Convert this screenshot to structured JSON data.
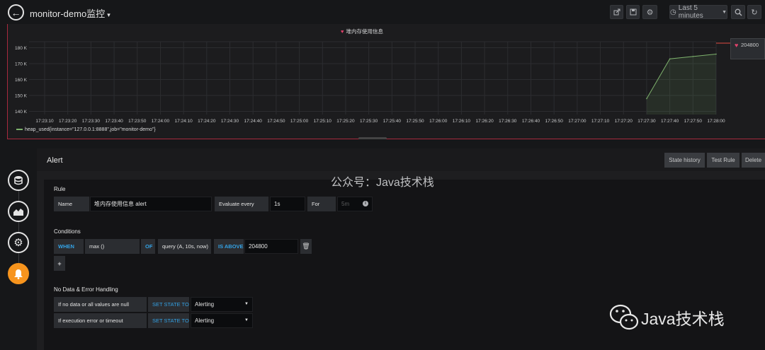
{
  "topbar": {
    "back_icon": "arrow-left-icon",
    "title": "monitor-demo监控",
    "title_caret": "▾",
    "time_range": "Last 5 minutes",
    "share_icon": "share-icon",
    "save_icon": "save-icon",
    "settings_icon": "gear-icon",
    "clock_icon": "clock-icon",
    "zoom_icon": "zoom-out-icon",
    "refresh_icon": "refresh-icon"
  },
  "panel": {
    "title": "堆内存使用信息",
    "threshold_label": "204800",
    "legend": "heap_used{instance=\"127.0.0.1:8888\",job=\"monitor-demo\"}"
  },
  "chart_data": {
    "type": "area",
    "title": "堆内存使用信息",
    "xlabel": "",
    "ylabel": "",
    "y_tick_labels": [
      "140 K",
      "150 K",
      "160 K",
      "170 K",
      "180 K"
    ],
    "y_ticks": [
      140,
      150,
      160,
      170,
      180
    ],
    "ylim": [
      138,
      182
    ],
    "x_tick_labels": [
      "17:23:10",
      "17:23:20",
      "17:23:30",
      "17:23:40",
      "17:23:50",
      "17:24:00",
      "17:24:10",
      "17:24:20",
      "17:24:30",
      "17:24:40",
      "17:24:50",
      "17:25:00",
      "17:25:10",
      "17:25:20",
      "17:25:30",
      "17:25:40",
      "17:25:50",
      "17:26:00",
      "17:26:10",
      "17:26:20",
      "17:26:30",
      "17:26:40",
      "17:26:50",
      "17:27:00",
      "17:27:10",
      "17:27:20",
      "17:27:30",
      "17:27:40",
      "17:27:50",
      "17:28:00"
    ],
    "grid": true,
    "legend_position": "bottom-left",
    "series": [
      {
        "name": "heap_used{instance=\"127.0.0.1:8888\",job=\"monitor-demo\"}",
        "color": "#7eb26d",
        "x": [
          "17:27:30",
          "17:27:40",
          "17:27:50",
          "17:28:00"
        ],
        "values": [
          148,
          173,
          174.5,
          176
        ]
      }
    ]
  },
  "sidebar": {
    "icons": [
      "database-icon",
      "chart-area-icon",
      "gear-icon",
      "bell-icon"
    ]
  },
  "alert": {
    "title": "Alert",
    "buttons": {
      "state_history": "State history",
      "test_rule": "Test Rule",
      "delete": "Delete"
    },
    "rule": {
      "section": "Rule",
      "name_label": "Name",
      "name_value": "堆内存使用信息 alert",
      "evaluate_label": "Evaluate every",
      "evaluate_value": "1s",
      "for_label": "For",
      "for_placeholder": "5m"
    },
    "conditions": {
      "section": "Conditions",
      "when": "WHEN",
      "reducer": "max ()",
      "of": "OF",
      "query": "query (A, 10s, now)",
      "evaluator": "IS ABOVE",
      "threshold": "204800"
    },
    "no_data": {
      "section": "No Data & Error Handling",
      "null_label": "If no data or all values are null",
      "null_set": "SET STATE TO",
      "null_value": "Alerting",
      "error_label": "If execution error or timeout",
      "error_set": "SET STATE TO",
      "error_value": "Alerting"
    }
  },
  "watermarks": {
    "top": "公众号：Java技术栈",
    "bottom": "Java技术栈"
  }
}
